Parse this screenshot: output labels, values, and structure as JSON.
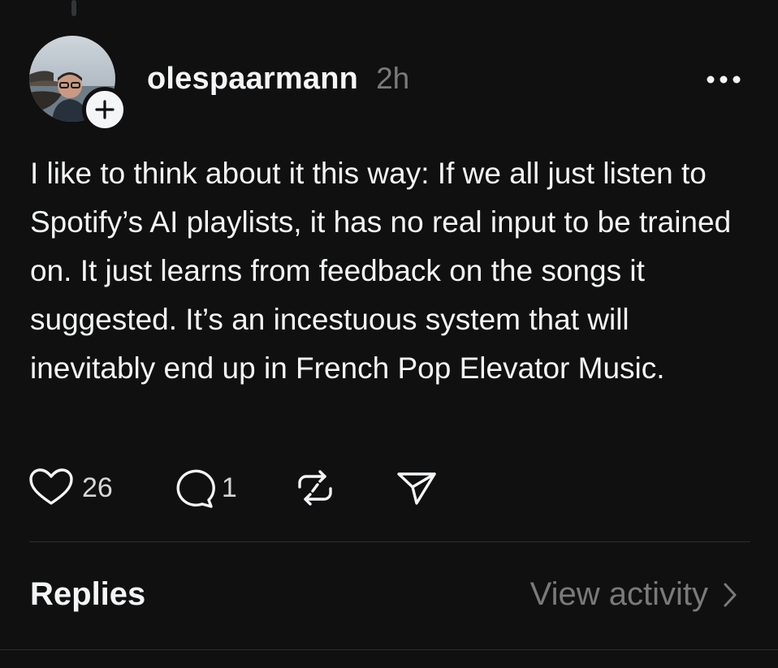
{
  "post": {
    "username": "olespaarmann",
    "timestamp": "2h",
    "text": "I like to think about it this way: If we all just listen to Spotify’s AI playlists, it has no real input to be trained on. It just learns from feedback on the songs it suggested. It’s an incestuous system that will inevitably end up in French Pop Elevator Music.",
    "avatar_icon": "profile-photo",
    "follow_icon": "plus-icon",
    "more_icon": "more-dots-icon"
  },
  "actions": {
    "like": {
      "icon": "heart-icon",
      "count": "26"
    },
    "reply": {
      "icon": "comment-icon",
      "count": "1"
    },
    "repost": {
      "icon": "repost-icon"
    },
    "share": {
      "icon": "send-icon"
    }
  },
  "replies_section": {
    "label": "Replies",
    "view_activity_label": "View activity",
    "chevron_icon": "chevron-right-icon"
  },
  "colors": {
    "background": "#101010",
    "primary_text": "#f3f5f7",
    "secondary_text": "#7a7a7a"
  }
}
